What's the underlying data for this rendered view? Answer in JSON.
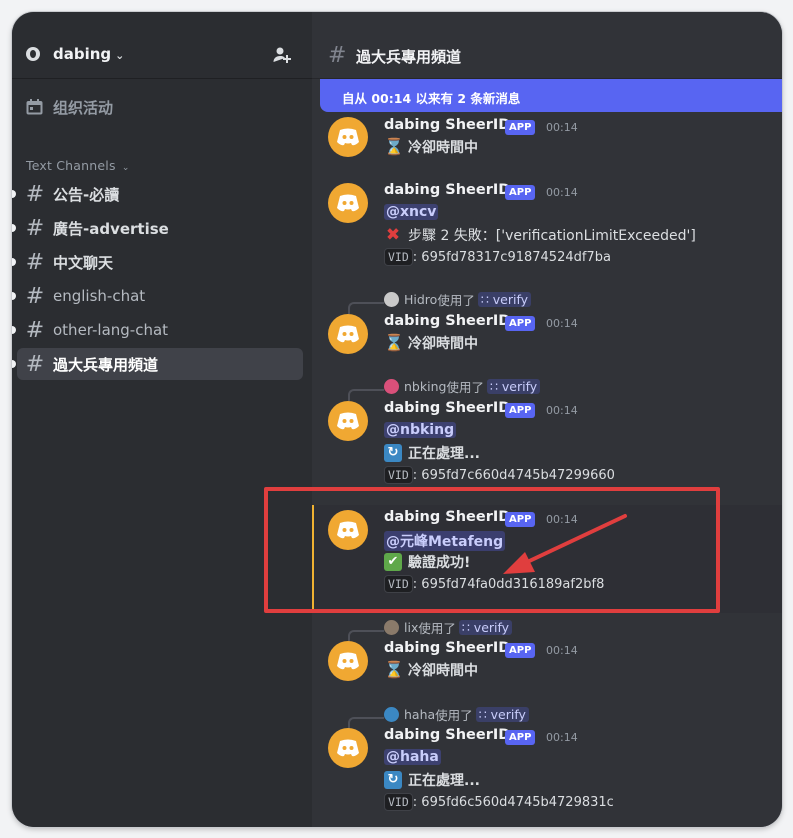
{
  "server": {
    "name": "dabing"
  },
  "sidebar": {
    "events_label": "组织活动",
    "category_label": "Text Channels",
    "channels": [
      {
        "name": "公告-必讀",
        "unread": true,
        "state": "unread"
      },
      {
        "name": "廣告-advertise",
        "unread": true,
        "state": "unread"
      },
      {
        "name": "中文聊天",
        "unread": true,
        "state": "unread"
      },
      {
        "name": "english-chat",
        "unread": true,
        "state": "muted"
      },
      {
        "name": "other-lang-chat",
        "unread": true,
        "state": "muted"
      },
      {
        "name": "過大兵專用頻道",
        "unread": true,
        "state": "active"
      }
    ]
  },
  "channel": {
    "title": "過大兵專用頻道",
    "new_messages_banner": "自从 00:14 以来有 2 条新消息"
  },
  "messages": [
    {
      "author": "dabing SheerID",
      "tag": "APP",
      "time": "00:14",
      "lines": {
        "status": "冷卻時間中"
      }
    },
    {
      "author": "dabing SheerID",
      "tag": "APP",
      "time": "00:14",
      "lines": {
        "mention": "@xncv",
        "status": "步驟 2 失敗：['verificationLimitExceeded']",
        "vid_label": "VID",
        "vid": ": 695fd78317c91874524df7ba"
      }
    },
    {
      "reply_user": "Hidro",
      "reply_text": "使用了",
      "reply_cmd": "verify",
      "author": "dabing SheerID",
      "tag": "APP",
      "time": "00:14",
      "lines": {
        "status": "冷卻時間中"
      }
    },
    {
      "reply_user": "nbking",
      "reply_text": "使用了",
      "reply_cmd": "verify",
      "author": "dabing SheerID",
      "tag": "APP",
      "time": "00:14",
      "lines": {
        "mention": "@nbking",
        "status": "正在處理...",
        "vid_label": "VID",
        "vid": ": 695fd7c660d4745b47299660"
      }
    },
    {
      "author": "dabing SheerID",
      "tag": "APP",
      "time": "00:14",
      "lines": {
        "mention": "@元峰Metafeng",
        "status": "驗證成功!",
        "vid_label": "VID",
        "vid": ": 695fd74fa0dd316189af2bf8"
      }
    },
    {
      "reply_user": "lix",
      "reply_text": "使用了",
      "reply_cmd": "verify",
      "author": "dabing SheerID",
      "tag": "APP",
      "time": "00:14",
      "lines": {
        "status": "冷卻時間中"
      }
    },
    {
      "reply_user": "haha",
      "reply_text": "使用了",
      "reply_cmd": "verify",
      "author": "dabing SheerID",
      "tag": "APP",
      "time": "00:14",
      "lines": {
        "mention": "@haha",
        "status": "正在處理...",
        "vid_label": "VID",
        "vid": ": 695fd6c560d4745b4729831c"
      }
    }
  ],
  "colors": {
    "accent": "#5865f2",
    "avatar": "#f0a832",
    "annotation": "#e03e3e"
  }
}
